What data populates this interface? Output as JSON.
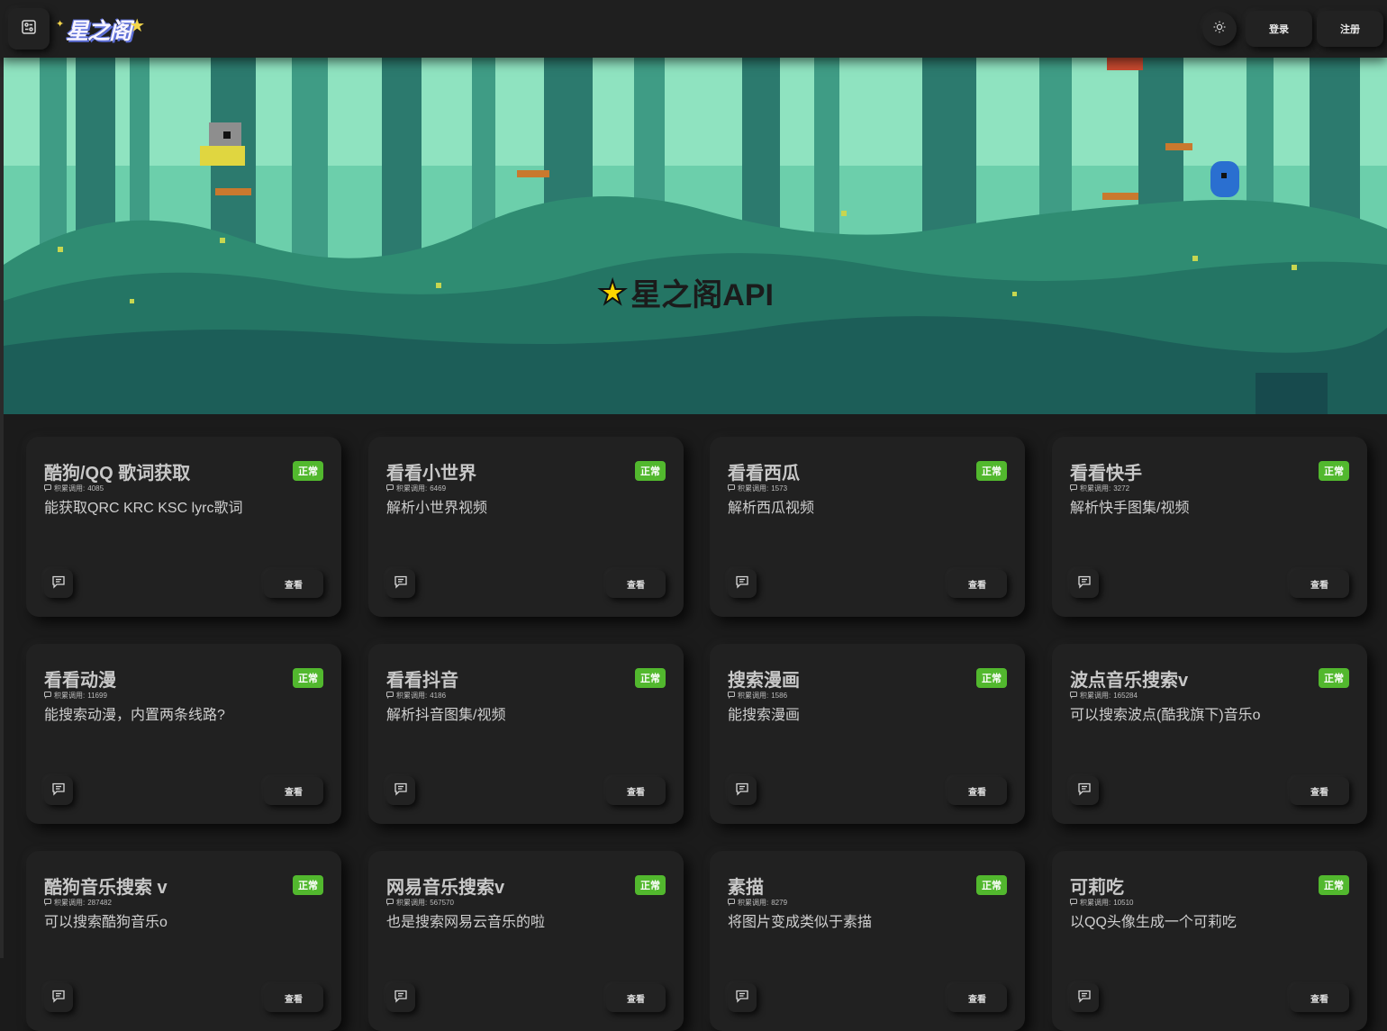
{
  "header": {
    "logo_text": "星之阁",
    "login_label": "登录",
    "register_label": "注册"
  },
  "banner": {
    "title": "星之阁API"
  },
  "colors": {
    "background": "#1b1b1b",
    "card": "#212121",
    "badge_green": "#52b82e"
  },
  "icons": {
    "menu": "panel-toggle-icon",
    "theme": "sun-icon",
    "comment": "message-square-icon",
    "count": "message-icon"
  },
  "cards": [
    {
      "title": "酷狗/QQ 歌词获取",
      "status": "正常",
      "count_label": "积累调用:",
      "count": "4085",
      "desc": "能获取QRC KRC KSC lyrc歌词",
      "view_label": "查看"
    },
    {
      "title": "看看小世界",
      "status": "正常",
      "count_label": "积累调用:",
      "count": "6469",
      "desc": "解析小世界视频",
      "view_label": "查看"
    },
    {
      "title": "看看西瓜",
      "status": "正常",
      "count_label": "积累调用:",
      "count": "1573",
      "desc": "解析西瓜视频",
      "view_label": "查看"
    },
    {
      "title": "看看快手",
      "status": "正常",
      "count_label": "积累调用:",
      "count": "3272",
      "desc": "解析快手图集/视频",
      "view_label": "查看"
    },
    {
      "title": "看看动漫",
      "status": "正常",
      "count_label": "积累调用:",
      "count": "11699",
      "desc": "能搜索动漫，内置两条线路?",
      "view_label": "查看"
    },
    {
      "title": "看看抖音",
      "status": "正常",
      "count_label": "积累调用:",
      "count": "4186",
      "desc": "解析抖音图集/视频",
      "view_label": "查看"
    },
    {
      "title": "搜索漫画",
      "status": "正常",
      "count_label": "积累调用:",
      "count": "1586",
      "desc": "能搜索漫画",
      "view_label": "查看"
    },
    {
      "title": "波点音乐搜索v",
      "status": "正常",
      "count_label": "积累调用:",
      "count": "165284",
      "desc": "可以搜索波点(酷我旗下)音乐o",
      "view_label": "查看"
    },
    {
      "title": "酷狗音乐搜索 v",
      "status": "正常",
      "count_label": "积累调用:",
      "count": "287482",
      "desc": "可以搜索酷狗音乐o",
      "view_label": "查看"
    },
    {
      "title": "网易音乐搜索v",
      "status": "正常",
      "count_label": "积累调用:",
      "count": "567570",
      "desc": "也是搜索网易云音乐的啦",
      "view_label": "查看"
    },
    {
      "title": "素描",
      "status": "正常",
      "count_label": "积累调用:",
      "count": "8279",
      "desc": "将图片变成类似于素描",
      "view_label": "查看"
    },
    {
      "title": "可莉吃",
      "status": "正常",
      "count_label": "积累调用:",
      "count": "10510",
      "desc": "以QQ头像生成一个可莉吃",
      "view_label": "查看"
    }
  ]
}
